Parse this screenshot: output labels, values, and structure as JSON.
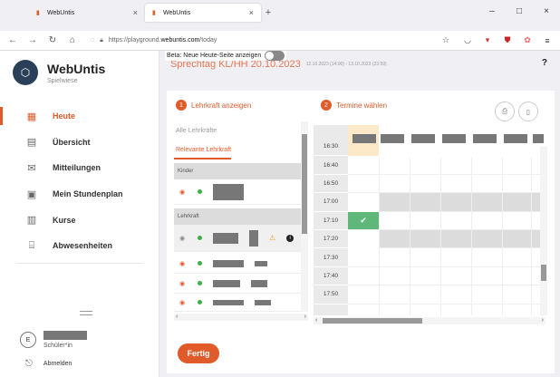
{
  "browser": {
    "tabs": [
      {
        "title": "WebUntis",
        "active": false
      },
      {
        "title": "WebUntis",
        "active": true
      }
    ],
    "new_tab": "+",
    "window_controls": {
      "minimize": "–",
      "maximize": "□",
      "close": "×"
    },
    "url_prefix": "https://playground.",
    "url_domain": "webuntis.com",
    "url_path": "/today"
  },
  "sidebar": {
    "brand_title": "WebUntis",
    "brand_subtitle": "Spielwiese",
    "items": [
      {
        "label": "Heute",
        "icon": "dashboard-icon",
        "active": true
      },
      {
        "label": "Übersicht",
        "icon": "overview-icon",
        "active": false
      },
      {
        "label": "Mitteilungen",
        "icon": "mail-icon",
        "active": false
      },
      {
        "label": "Mein Stundenplan",
        "icon": "calendar-icon",
        "active": false
      },
      {
        "label": "Kurse",
        "icon": "courses-icon",
        "active": false
      },
      {
        "label": "Abwesenheiten",
        "icon": "absence-icon",
        "active": false
      }
    ],
    "user_initial": "E",
    "user_role": "Schüler*in",
    "logout_label": "Abmelden"
  },
  "main": {
    "page_title": "Sprechtag KL/HH 20.10.2023",
    "beta_label": "Beta: Neue Heute-Seite anzeigen",
    "time_range": "12.10.2023 (14:00) - 13.10.2023 (23:59)",
    "help": "?",
    "step1": {
      "num": "1",
      "label": "Lehrkraft anzeigen"
    },
    "step2": {
      "num": "2",
      "label": "Termine wählen"
    },
    "filters": {
      "all": "Alle Lehrkräfte",
      "relevant": "Relevante Lehrkraft"
    },
    "groups": {
      "kinder": "Kinder",
      "lehrkraft": "Lehrkraft"
    },
    "times": [
      "16:30",
      "16:40",
      "16:50",
      "17:00",
      "17:10",
      "17:20",
      "17:30",
      "17:40",
      "17:50"
    ],
    "done_label": "Fertig"
  },
  "colors": {
    "accent": "#e05a2a",
    "booked": "#5fb87a",
    "brand_dark": "#2a4058"
  }
}
